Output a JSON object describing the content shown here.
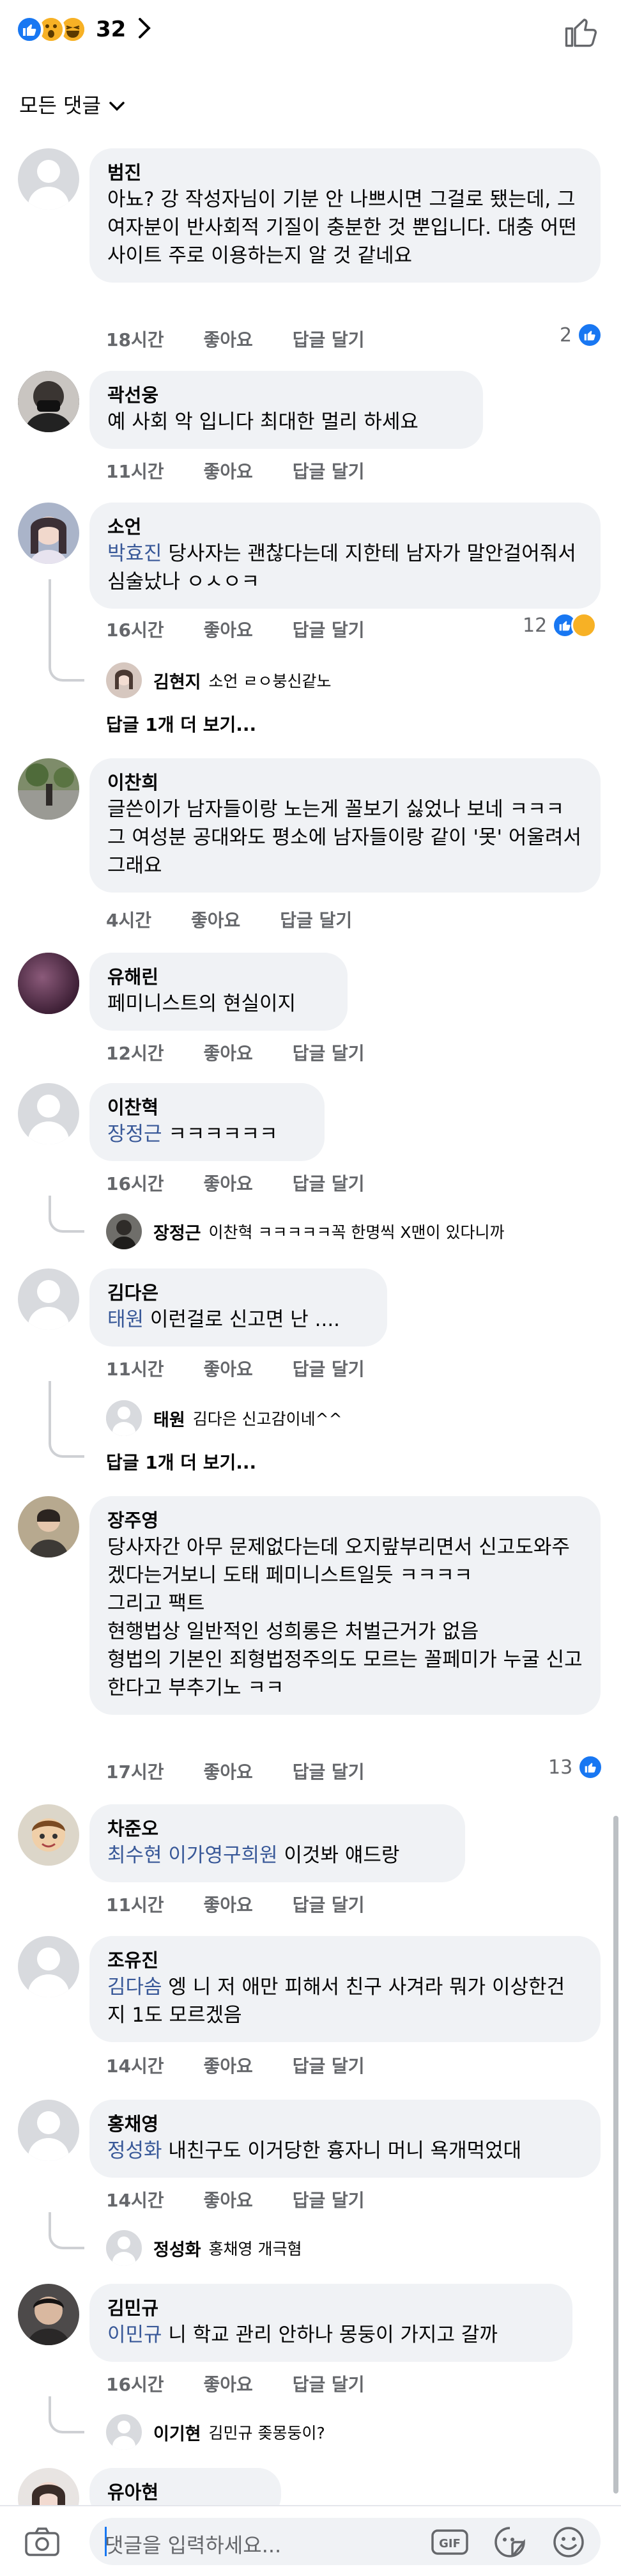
{
  "reactions": {
    "count": "32",
    "icons": [
      "like-icon",
      "wow-icon",
      "haha-icon"
    ]
  },
  "sort_label": "모든 댓글",
  "comments": [
    {
      "author": "범진",
      "text": "아뇨? 강 작성자님이 기분 안 나쁘시면 그걸로 됐는데, 그 여자분이 반사회적 기질이 충분한 것 뿐입니다. 대충 어떤 사이트 주로 이용하는지 알 것 같네요",
      "time": "18시간",
      "like": "좋아요",
      "reply": "답글 달기",
      "reactions": "2"
    },
    {
      "author": "곽선웅",
      "text": "예 사회 악 입니다 최대한 멀리 하세요",
      "time": "11시간",
      "like": "좋아요",
      "reply": "답글 달기"
    },
    {
      "author": "소언",
      "tag": "박효진",
      "text": " 당사자는 괜찮다는데 지한테 남자가 말안걸어줘서 심술났나 ㅇㅅㅇㅋ",
      "time": "16시간",
      "like": "좋아요",
      "reply": "답글 달기",
      "reactions": "12",
      "replies": [
        {
          "name": "김현지",
          "text": "소언 ㄹㅇ붕신같노"
        }
      ],
      "more": "답글 1개 더 보기..."
    },
    {
      "author": "이찬희",
      "text": "글쓴이가 남자들이랑 노는게 꼴보기 싫었나 보네 ㅋㅋㅋ 그 여성분 공대와도 평소에 남자들이랑 같이 '못' 어울려서 그래요",
      "time": "4시간",
      "like": "좋아요",
      "reply": "답글 달기"
    },
    {
      "author": "유해린",
      "text": "페미니스트의 현실이지",
      "time": "12시간",
      "like": "좋아요",
      "reply": "답글 달기"
    },
    {
      "author": "이찬혁",
      "tag": "장정근",
      "text": " ㅋㅋㅋㅋㅋㅋ",
      "time": "16시간",
      "like": "좋아요",
      "reply": "답글 달기",
      "replies": [
        {
          "name": "장정근",
          "text": "이찬혁 ㅋㅋㅋㅋㅋ꼭 한명씩 X맨이 있다니까"
        }
      ]
    },
    {
      "author": "김다은",
      "tag": "태원",
      "text": " 이런걸로 신고면 난 ....",
      "time": "11시간",
      "like": "좋아요",
      "reply": "답글 달기",
      "replies": [
        {
          "name": "태원",
          "text": "김다은 신고감이네^^"
        }
      ],
      "more": "답글 1개 더 보기..."
    },
    {
      "author": "장주영",
      "text": "당사자간 아무 문제없다는데 오지랖부리면서 신고도와주겠다는거보니 도태 페미니스트일듯 ㅋㅋㅋㅋ\n그리고 팩트\n현행법상 일반적인 성희롱은 처벌근거가 없음\n형법의 기본인 죄형법정주의도 모르는 꼴페미가 누굴 신고한다고 부추기노 ㅋㅋ",
      "time": "17시간",
      "like": "좋아요",
      "reply": "답글 달기",
      "reactions": "13"
    },
    {
      "author": "차준오",
      "tag": "최수현 이가영구희원",
      "text": " 이것봐 얘드랑",
      "time": "11시간",
      "like": "좋아요",
      "reply": "답글 달기"
    },
    {
      "author": "조유진",
      "tag": "김다솜",
      "text": " 엥 니 저 애만 피해서 친구 사겨라 뭐가 이상한건지 1도 모르겠음",
      "time": "14시간",
      "like": "좋아요",
      "reply": "답글 달기"
    },
    {
      "author": "홍채영",
      "tag": "정성화",
      "text": " 내친구도 이거당한 흉자니 머니 욕개먹었대",
      "time": "14시간",
      "like": "좋아요",
      "reply": "답글 달기",
      "replies": [
        {
          "name": "정성화",
          "text": "홍채영 개극혐"
        }
      ]
    },
    {
      "author": "김민규",
      "tag": "이민규",
      "text": " 니 학교 관리 안하나 몽둥이 가지고 갈까",
      "time": "16시간",
      "like": "좋아요",
      "reply": "답글 달기",
      "replies": [
        {
          "name": "이기현",
          "text": "김민규 좆몽둥이?"
        }
      ]
    },
    {
      "author": "유아현"
    }
  ],
  "composer": {
    "placeholder": "댓글을 입력하세요..."
  },
  "colors": {
    "accent": "#1877f2",
    "link": "#385898",
    "bubble": "#f0f2f5",
    "meta": "#65676b"
  }
}
